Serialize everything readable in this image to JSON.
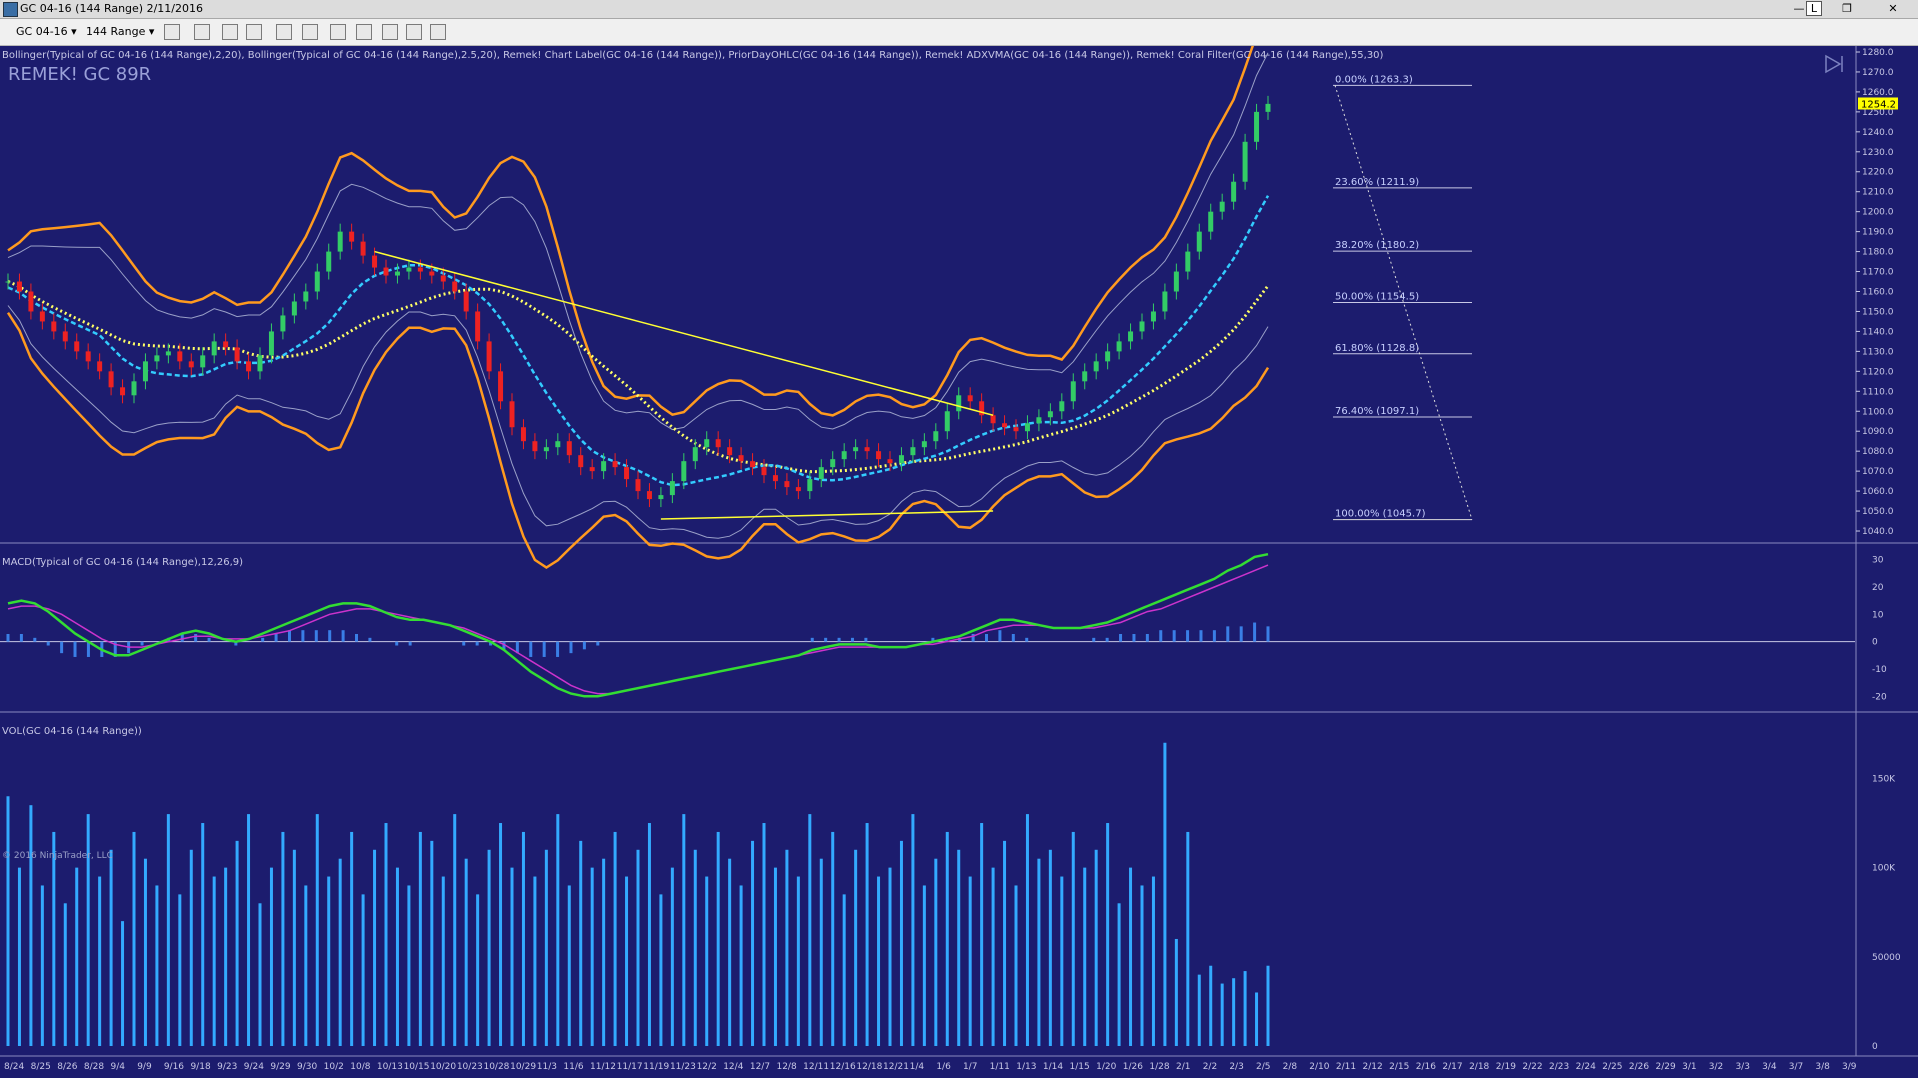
{
  "window": {
    "title": "GC 04-16 (144 Range)  2/11/2016"
  },
  "toolbar": {
    "instrument": "GC 04-16",
    "period": "144 Range"
  },
  "colors": {
    "background": "#1c1c6e",
    "bollinger_outer": "#ff9a1f",
    "bollinger_inner": "#9aa0c8",
    "trendline": "#ffff33",
    "macd": "#33dd33",
    "signal": "#cc33cc",
    "histogram": "#3a7fe6",
    "volume": "#33aaff",
    "up_bar": "#33cc66",
    "down_bar": "#ee2222",
    "last_price_tag": "#ffff00"
  },
  "labels": {
    "indicators": "Bollinger(Typical of GC 04-16 (144 Range),2,20), Bollinger(Typical of GC 04-16 (144 Range),2.5,20), Remek! Chart Label(GC 04-16 (144 Range)), PriorDayOHLC(GC 04-16 (144 Range)), Remek! ADXVMA(GC 04-16 (144 Range)), Remek! Coral Filter(GC 04-16 (144 Range),55,30)",
    "chart_name": "REMEK! GC 89R",
    "macd_title": "MACD(Typical of GC 04-16 (144 Range),12,26,9)",
    "vol_title": "VOL(GC 04-16 (144 Range))",
    "copyright": "© 2016 NinjaTrader, LLC",
    "last_price": "1254.2"
  },
  "chart_data": [
    {
      "type": "candlestick",
      "title": "REMEK! GC 89R",
      "ylim": [
        1035,
        1283
      ],
      "yticks": [
        1040,
        1050,
        1060,
        1070,
        1080,
        1090,
        1100,
        1110,
        1120,
        1130,
        1140,
        1150,
        1160,
        1170,
        1180,
        1190,
        1200,
        1210,
        1220,
        1230,
        1240,
        1250,
        1260,
        1270,
        1280
      ],
      "ytick_labels": [
        "1040.0",
        "1050.0",
        "1060.0",
        "1070.0",
        "1080.0",
        "1090.0",
        "1100.0",
        "1110.0",
        "1120.0",
        "1130.0",
        "1140.0",
        "1150.0",
        "1160.0",
        "1170.0",
        "1180.0",
        "1190.0",
        "1200.0",
        "1210.0",
        "1220.0",
        "1230.0",
        "1240.0",
        "1250.0",
        "1260.0",
        "1270.0",
        "1280.0"
      ],
      "last_price": 1254.2,
      "fibonacci": [
        {
          "label": "0.00% (1263.3)",
          "price": 1263.3
        },
        {
          "label": "23.60% (1211.9)",
          "price": 1211.9
        },
        {
          "label": "38.20% (1180.2)",
          "price": 1180.2
        },
        {
          "label": "50.00% (1154.5)",
          "price": 1154.5
        },
        {
          "label": "61.80% (1128.8)",
          "price": 1128.8
        },
        {
          "label": "76.40% (1097.1)",
          "price": 1097.1
        },
        {
          "label": "100.00% (1045.7)",
          "price": 1045.7
        }
      ],
      "series_close": [
        1165,
        1160,
        1150,
        1145,
        1140,
        1135,
        1130,
        1125,
        1120,
        1112,
        1108,
        1115,
        1125,
        1128,
        1130,
        1125,
        1122,
        1128,
        1135,
        1132,
        1125,
        1120,
        1128,
        1140,
        1148,
        1155,
        1160,
        1170,
        1180,
        1190,
        1185,
        1178,
        1172,
        1168,
        1170,
        1172,
        1170,
        1168,
        1165,
        1160,
        1150,
        1135,
        1120,
        1105,
        1092,
        1085,
        1080,
        1082,
        1085,
        1078,
        1072,
        1070,
        1075,
        1072,
        1066,
        1060,
        1056,
        1058,
        1065,
        1075,
        1082,
        1086,
        1082,
        1078,
        1075,
        1072,
        1068,
        1065,
        1062,
        1060,
        1066,
        1072,
        1076,
        1080,
        1082,
        1080,
        1076,
        1074,
        1078,
        1082,
        1085,
        1090,
        1100,
        1108,
        1105,
        1098,
        1094,
        1092,
        1090,
        1094,
        1097,
        1100,
        1105,
        1115,
        1120,
        1125,
        1130,
        1135,
        1140,
        1145,
        1150,
        1160,
        1170,
        1180,
        1190,
        1200,
        1205,
        1215,
        1235,
        1250,
        1254
      ]
    },
    {
      "type": "line",
      "title": "MACD(Typical of GC 04-16 (144 Range),12,26,9)",
      "ylim": [
        -25,
        35
      ],
      "yticks": [
        -20,
        -10,
        0,
        10,
        20,
        30
      ],
      "ytick_labels": [
        "-20",
        "-10",
        "0",
        "10",
        "20",
        "30"
      ],
      "series": [
        {
          "values": [
            14,
            15,
            14,
            11,
            7,
            3,
            0,
            -3,
            -5,
            -5,
            -3,
            -1,
            1,
            3,
            4,
            3,
            1,
            0,
            1,
            3,
            5,
            7,
            9,
            11,
            13,
            14,
            14,
            13,
            11,
            9,
            8,
            8,
            7,
            6,
            4,
            2,
            0,
            -3,
            -7,
            -11,
            -14,
            -17,
            -19,
            -20,
            -20,
            -19,
            -18,
            -17,
            -16,
            -15,
            -14,
            -13,
            -12,
            -11,
            -10,
            -9,
            -8,
            -7,
            -6,
            -5,
            -3,
            -2,
            -1,
            -1,
            -1,
            -2,
            -2,
            -2,
            -1,
            0,
            1,
            2,
            4,
            6,
            8,
            8,
            7,
            6,
            5,
            5,
            5,
            6,
            7,
            9,
            11,
            13,
            15,
            17,
            19,
            21,
            23,
            26,
            28,
            31,
            32
          ]
        },
        {
          "values": [
            12,
            13,
            13,
            12,
            10,
            7,
            4,
            1,
            -1,
            -2,
            -2,
            -1,
            0,
            1,
            2,
            2,
            1,
            1,
            1,
            2,
            3,
            4,
            6,
            8,
            10,
            11,
            12,
            12,
            11,
            10,
            9,
            8,
            7,
            6,
            5,
            3,
            1,
            -1,
            -4,
            -7,
            -10,
            -13,
            -16,
            -18,
            -19,
            -19,
            -18,
            -17,
            -16,
            -15,
            -14,
            -13,
            -12,
            -11,
            -10,
            -9,
            -8,
            -7,
            -6,
            -5,
            -4,
            -3,
            -2,
            -2,
            -2,
            -2,
            -2,
            -2,
            -1,
            -1,
            0,
            1,
            2,
            4,
            5,
            6,
            6,
            6,
            5,
            5,
            5,
            5,
            6,
            7,
            9,
            11,
            12,
            14,
            16,
            18,
            20,
            22,
            24,
            26,
            28
          ]
        }
      ]
    },
    {
      "type": "bar",
      "title": "VOL(GC 04-16 (144 Range))",
      "ylim": [
        0,
        185000
      ],
      "yticks": [
        0,
        50000,
        100000,
        150000
      ],
      "ytick_labels": [
        "0",
        "50000",
        "100K",
        "150K"
      ],
      "values": [
        140000,
        100000,
        135000,
        90000,
        120000,
        80000,
        100000,
        130000,
        95000,
        110000,
        70000,
        120000,
        105000,
        90000,
        130000,
        85000,
        110000,
        125000,
        95000,
        100000,
        115000,
        130000,
        80000,
        100000,
        120000,
        110000,
        90000,
        130000,
        95000,
        105000,
        120000,
        85000,
        110000,
        125000,
        100000,
        90000,
        120000,
        115000,
        95000,
        130000,
        105000,
        85000,
        110000,
        125000,
        100000,
        120000,
        95000,
        110000,
        130000,
        90000,
        115000,
        100000,
        105000,
        120000,
        95000,
        110000,
        125000,
        85000,
        100000,
        130000,
        110000,
        95000,
        120000,
        105000,
        90000,
        115000,
        125000,
        100000,
        110000,
        95000,
        130000,
        105000,
        120000,
        85000,
        110000,
        125000,
        95000,
        100000,
        115000,
        130000,
        90000,
        105000,
        120000,
        110000,
        95000,
        125000,
        100000,
        115000,
        90000,
        130000,
        105000,
        110000,
        95000,
        120000,
        100000,
        110000,
        125000,
        80000,
        100000,
        90000,
        95000,
        170000,
        60000,
        120000,
        40000,
        45000,
        35000,
        38000,
        42000,
        30000,
        45000
      ]
    }
  ],
  "xaxis": {
    "labels": [
      "8/24",
      "8/25",
      "8/26",
      "8/28",
      "9/4",
      "9/9",
      "9/16",
      "9/18",
      "9/23",
      "9/24",
      "9/29",
      "9/30",
      "10/2",
      "10/8",
      "10/13",
      "10/15",
      "10/20",
      "10/23",
      "10/28",
      "10/29",
      "11/3",
      "11/6",
      "11/12",
      "11/17",
      "11/19",
      "11/23",
      "12/2",
      "12/4",
      "12/7",
      "12/8",
      "12/11",
      "12/16",
      "12/18",
      "12/21",
      "1/4",
      "1/6",
      "1/7",
      "1/11",
      "1/13",
      "1/14",
      "1/15",
      "1/20",
      "1/26",
      "1/28",
      "2/1",
      "2/2",
      "2/3",
      "2/5",
      "2/8",
      "2/10",
      "2/11",
      "2/12",
      "2/15",
      "2/16",
      "2/17",
      "2/18",
      "2/19",
      "2/22",
      "2/23",
      "2/24",
      "2/25",
      "2/26",
      "2/29",
      "3/1",
      "3/2",
      "3/3",
      "3/4",
      "3/7",
      "3/8",
      "3/9"
    ]
  }
}
